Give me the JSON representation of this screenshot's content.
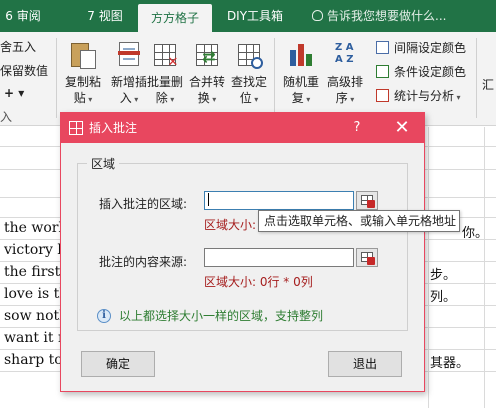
{
  "ribbon_tabs": [
    {
      "label": "6 审阅"
    },
    {
      "label": "7 视图"
    },
    {
      "label": "方方格子"
    },
    {
      "label": "DIY工具箱"
    }
  ],
  "tell_me": "告诉我您想要做什么...",
  "ribbon_left": {
    "line1": "舍五入",
    "line2": "保留数值",
    "plus": "+ ▾",
    "line4": "入"
  },
  "ribbon_buttons": [
    {
      "line1": "复制粘",
      "line2": "贴"
    },
    {
      "line1": "新增插",
      "line2": "入"
    },
    {
      "line1": "批量删",
      "line2": "除"
    },
    {
      "line1": "合并转",
      "line2": "换"
    },
    {
      "line1": "查找定",
      "line2": "位"
    },
    {
      "line1": "随机重",
      "line2": "复"
    },
    {
      "line1": "高级排",
      "line2": "序"
    }
  ],
  "ribbon_small": [
    {
      "label": "间隔设定颜色"
    },
    {
      "label": "条件设定颜色"
    },
    {
      "label": "统计与分析"
    }
  ],
  "ribbon_right_edge": "汇",
  "sheet_rows": [
    {
      "left": "the worl",
      "right": "你。"
    },
    {
      "left": "victory b",
      "right": ""
    },
    {
      "left": "the first",
      "right": "步。"
    },
    {
      "left": "love is th",
      "right": "列。"
    },
    {
      "left": "sow noth",
      "right": ""
    },
    {
      "left": "want it m",
      "right": ""
    },
    {
      "left": "sharp to",
      "right": "其器。"
    }
  ],
  "dialog": {
    "title": "插入批注",
    "help": "?",
    "close": "✕",
    "group_label": "区域",
    "field1_label": "插入批注的区域:",
    "field1_value": "",
    "field1_size": "区域大小:",
    "field2_label": "批注的内容来源:",
    "field2_value": "",
    "field2_size": "区域大小: 0行 * 0列",
    "info": "以上都选择大小一样的区域，支持整列",
    "ok": "确定",
    "cancel": "退出"
  },
  "tooltip": "点击选取单元格、或输入单元格地址",
  "colors": {
    "ribbon_green": "#217346",
    "dialog_title": "#e8475f",
    "size_text": "#a51d1d",
    "info_text": "#2e7d32"
  }
}
